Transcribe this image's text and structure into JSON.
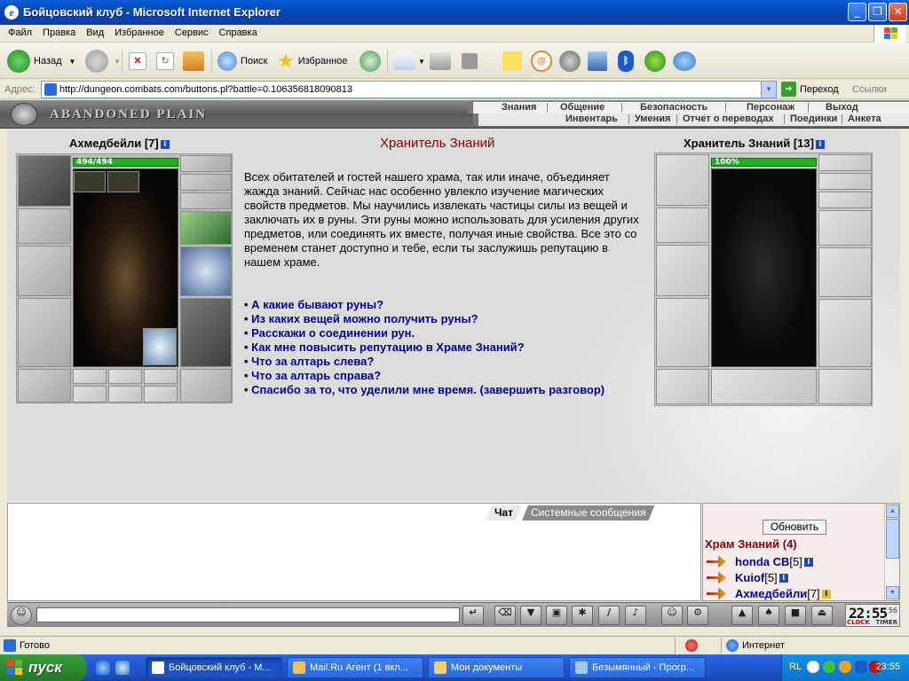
{
  "window": {
    "title": "Бойцовский клуб - Microsoft Internet Explorer"
  },
  "menu": [
    "Файл",
    "Правка",
    "Вид",
    "Избранное",
    "Сервис",
    "Справка"
  ],
  "toolbar": {
    "back": "Назад",
    "search": "Поиск",
    "favorites": "Избранное"
  },
  "address": {
    "label": "Адрес:",
    "url": "http://dungeon.combats.com/buttons.pl?battle=0.106356818090813",
    "go": "Переход",
    "links": "Ссылки"
  },
  "game": {
    "location": "ABANDONED PLAIN",
    "nav_top": [
      "Знания",
      "Общение",
      "Безопасность",
      "Персонаж",
      "Выход"
    ],
    "nav_bottom": [
      "Инвентарь",
      "Умения",
      "Отчет о переводах",
      "Поединки",
      "Анкета"
    ]
  },
  "player": {
    "name": "Ахмедбейли",
    "level": "[7]",
    "hp": "494/494"
  },
  "npc": {
    "name": "Хранитель Знаний",
    "level": "[13]",
    "hp": "100%",
    "title": "Хранитель Знаний",
    "text": "Всех обитателей и гостей нашего храма, так или иначе, объединяет жажда знаний. Сейчас нас особенно увлекло изучение магических свойств предметов. Мы научились извлекать частицы силы из вещей и заключать их в руны. Эти руны можно использовать для усиления других предметов, или соединять их вместе, получая иные свойства. Все это со временем станет доступно и тебе, если ты заслужишь репутацию в нашем храме.",
    "options": [
      "А какие бывают руны?",
      "Из каких вещей можно получить руны?",
      "Расскажи о соединении рун.",
      "Как мне повысить репутацию в Храме Знаний?",
      "Что за алтарь слева?",
      "Что за алтарь справа?",
      "Спасибо за то, что уделили мне время. (завершить разговор)"
    ]
  },
  "chat": {
    "tabs": [
      "Чат",
      "Системные сообщения"
    ]
  },
  "room": {
    "refresh": "Обновить",
    "name": "Храм Знаний (4)",
    "users": [
      {
        "name": "honda CB",
        "level": "[5]"
      },
      {
        "name": "Kuiof",
        "level": "[5]"
      },
      {
        "name": "Ахмедбейли",
        "level": "[7]"
      }
    ]
  },
  "clock": {
    "time": "22:55",
    "seconds": "56",
    "clock_label": "CLOCK",
    "timer_label": "TIMER"
  },
  "status": {
    "text": "Готово",
    "zone": "Интернет"
  },
  "taskbar": {
    "start": "пуск",
    "tasks": [
      "Бойцовский клуб - М...",
      "Mail.Ru Агент (1 вкл...",
      "Мои документы",
      "Безымянный - Прогр..."
    ],
    "lang": "RL",
    "time": "23:55"
  },
  "colors": {
    "npc_title": "#8b0000",
    "link": "#0000a0",
    "hp_green": "#20b020",
    "xp_blue": "#245edb"
  }
}
